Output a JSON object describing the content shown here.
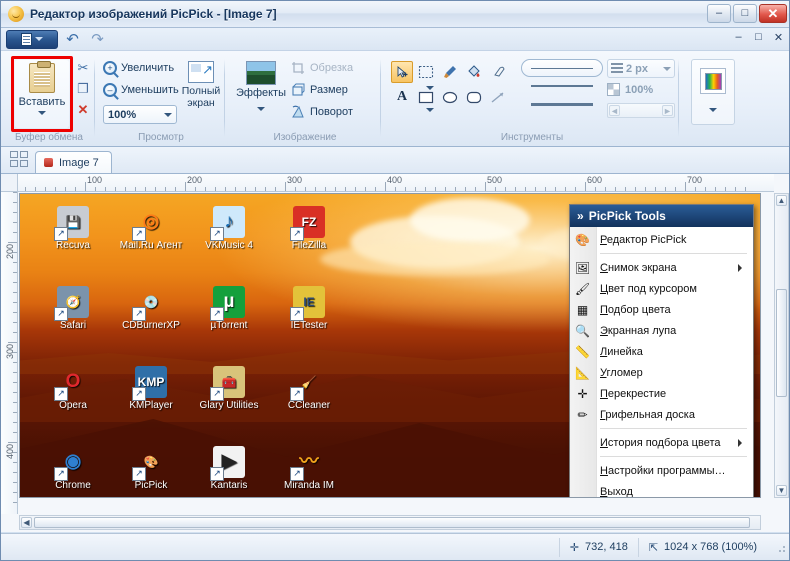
{
  "window": {
    "title": "Редактор изображений PicPick - [Image 7]",
    "minimize": "–",
    "maximize": "□",
    "close": "✕"
  },
  "quick_access": {
    "undo": "↶",
    "redo": "↷",
    "mdi_minimize": "–",
    "mdi_restore": "□",
    "mdi_close": "✕"
  },
  "ribbon": {
    "clipboard": {
      "group_label": "Буфер обмена",
      "paste_label": "Вставить",
      "cut_icon": "✂",
      "copy_icon": "❐",
      "delete_icon": "✕"
    },
    "view": {
      "group_label": "Просмотр",
      "zoom_in": "Увеличить",
      "zoom_out": "Уменьшить",
      "zoom_value": "100%",
      "fullscreen": "Полный экран"
    },
    "image": {
      "group_label": "Изображение",
      "effects": "Эффекты",
      "crop": "Обрезка",
      "resize": "Размер",
      "rotate": "Поворот"
    },
    "tools": {
      "group_label": "Инструменты",
      "row1": [
        "select-arrow",
        "rect-select",
        "brush",
        "fill",
        "eraser"
      ],
      "row2": [
        "text",
        "rectangle",
        "ellipse",
        "rounded-rect",
        "line"
      ],
      "line_width": "2 px",
      "opacity": "100%"
    },
    "palette": {
      "swatch_label": "color-palette"
    }
  },
  "tabs": {
    "active": "Image 7"
  },
  "rulers": {
    "horizontal": [
      "100",
      "200",
      "300",
      "400",
      "500",
      "600",
      "700"
    ],
    "vertical": [
      "200",
      "300",
      "400"
    ]
  },
  "desktop_icons": [
    {
      "name": "Recuva",
      "glyph": "💾",
      "bg": "#c8ccd2",
      "fg": "#3a4553"
    },
    {
      "name": "Mail.Ru Агент",
      "glyph": "◎",
      "bg": "transparent",
      "fg": "#ff7a18"
    },
    {
      "name": "VKMusic 4",
      "glyph": "♪",
      "bg": "#cfe9fb",
      "fg": "#1a6fb5"
    },
    {
      "name": "FileZilla",
      "glyph": "FZ",
      "bg": "#d93025",
      "fg": "#ffffff"
    },
    {
      "name": "Safari",
      "glyph": "🧭",
      "bg": "#7b93ab",
      "fg": "#ffffff"
    },
    {
      "name": "CDBurnerXP",
      "glyph": "💿",
      "bg": "transparent",
      "fg": "#2f7fd0"
    },
    {
      "name": "µTorrent",
      "glyph": "µ",
      "bg": "#14a03c",
      "fg": "#ffffff"
    },
    {
      "name": "IETester",
      "glyph": "IE",
      "bg": "#e3c23a",
      "fg": "#2a4a7a"
    },
    {
      "name": "Opera",
      "glyph": "O",
      "bg": "transparent",
      "fg": "#e0282e"
    },
    {
      "name": "KMPlayer",
      "glyph": "KMP",
      "bg": "#2f6fa8",
      "fg": "#ffffff"
    },
    {
      "name": "Glary Utilities",
      "glyph": "🧰",
      "bg": "#d8c37a",
      "fg": "#5a4410"
    },
    {
      "name": "CCleaner",
      "glyph": "🧹",
      "bg": "transparent",
      "fg": "#d1332b"
    },
    {
      "name": "Chrome",
      "glyph": "◉",
      "bg": "transparent",
      "fg": "#2f7fd0"
    },
    {
      "name": "PicPick",
      "glyph": "🎨",
      "bg": "transparent",
      "fg": "#e8a33d"
    },
    {
      "name": "Kantaris",
      "glyph": "▶",
      "bg": "#f2f2f2",
      "fg": "#222222"
    },
    {
      "name": "Miranda IM",
      "glyph": "〰",
      "bg": "transparent",
      "fg": "#f0a31c"
    }
  ],
  "picpick_menu": {
    "header": "PicPick Tools",
    "header_chevrons": "»",
    "items": [
      {
        "label": "Редактор PicPick",
        "icon": "palette-icon",
        "glyph": "🎨",
        "submenu": false,
        "separator_after": true
      },
      {
        "label": "Снимок экрана",
        "icon": "screenshot-icon",
        "glyph": "🖼",
        "submenu": true,
        "separator_after": false
      },
      {
        "label": "Цвет под курсором",
        "icon": "color-picker-icon",
        "glyph": "🖌",
        "submenu": false,
        "separator_after": false
      },
      {
        "label": "Подбор цвета",
        "icon": "color-grid-icon",
        "glyph": "▦",
        "submenu": false,
        "separator_after": false
      },
      {
        "label": "Экранная лупа",
        "icon": "magnifier-icon",
        "glyph": "🔍",
        "submenu": false,
        "separator_after": false
      },
      {
        "label": "Линейка",
        "icon": "ruler-icon",
        "glyph": "📏",
        "submenu": false,
        "separator_after": false
      },
      {
        "label": "Угломер",
        "icon": "protractor-icon",
        "glyph": "📐",
        "submenu": false,
        "separator_after": false
      },
      {
        "label": "Перекрестие",
        "icon": "crosshair-icon",
        "glyph": "✛",
        "submenu": false,
        "separator_after": false
      },
      {
        "label": "Грифельная доска",
        "icon": "pencil-icon",
        "glyph": "✏",
        "submenu": false,
        "separator_after": true
      },
      {
        "label": "История подбора цвета",
        "icon": "none",
        "glyph": "",
        "submenu": true,
        "separator_after": true
      },
      {
        "label": "Настройки программы…",
        "icon": "none",
        "glyph": "",
        "submenu": false,
        "separator_after": false
      },
      {
        "label": "Выход",
        "icon": "none",
        "glyph": "",
        "submenu": false,
        "separator_after": false
      }
    ]
  },
  "status_bar": {
    "cursor_icon": "✛",
    "cursor_position": "732, 418",
    "size_icon": "⇱",
    "image_size": "1024 x 768  (100%)"
  },
  "colors": {
    "accent": "#1d4177",
    "highlight_box": "#ee0000",
    "menu_header_from": "#2a5c97",
    "menu_header_to": "#12325c",
    "selected_tool": "#f7c463"
  }
}
